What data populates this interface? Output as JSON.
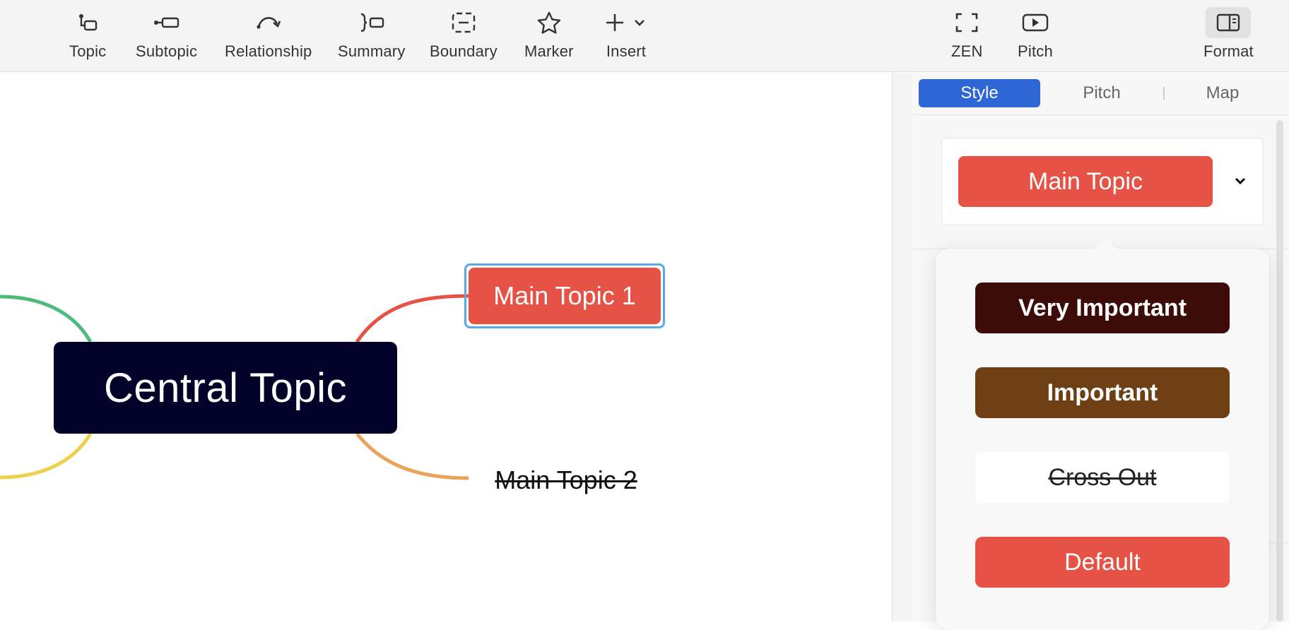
{
  "toolbar": {
    "left_items": [
      {
        "label": "Topic",
        "icon": "topic-icon"
      },
      {
        "label": "Subtopic",
        "icon": "subtopic-icon"
      },
      {
        "label": "Relationship",
        "icon": "relationship-icon"
      },
      {
        "label": "Summary",
        "icon": "summary-icon"
      },
      {
        "label": "Boundary",
        "icon": "boundary-icon"
      },
      {
        "label": "Marker",
        "icon": "star-icon"
      },
      {
        "label": "Insert",
        "icon": "plus-icon"
      }
    ],
    "right_items": [
      {
        "label": "ZEN",
        "icon": "fullscreen-icon"
      },
      {
        "label": "Pitch",
        "icon": "play-icon"
      },
      {
        "label": "Format",
        "icon": "sidebar-panel-icon"
      }
    ]
  },
  "canvas": {
    "central_topic": "Central Topic",
    "main_topic_1": "Main Topic 1",
    "main_topic_2": "Main Topic 2",
    "colors": {
      "central": "#03032a",
      "topic_red": "#e65245",
      "branch_green": "#4dbb7c",
      "branch_yellow": "#ecd24a",
      "branch_red": "#e65245",
      "branch_orange": "#eba25a",
      "selection": "#5aa9e6"
    }
  },
  "panel": {
    "tabs": [
      {
        "label": "Style",
        "active": true
      },
      {
        "label": "Pitch",
        "active": false
      },
      {
        "label": "Map",
        "active": false
      }
    ],
    "style_preview": "Main Topic",
    "style_options": [
      {
        "label": "Very Important",
        "bg": "#3d0b08"
      },
      {
        "label": "Important",
        "bg": "#6e3f13"
      },
      {
        "label": "Cross Out",
        "bg": "#ffffff"
      },
      {
        "label": "Default",
        "bg": "#e65245"
      }
    ],
    "accent": "#2f66d6"
  }
}
